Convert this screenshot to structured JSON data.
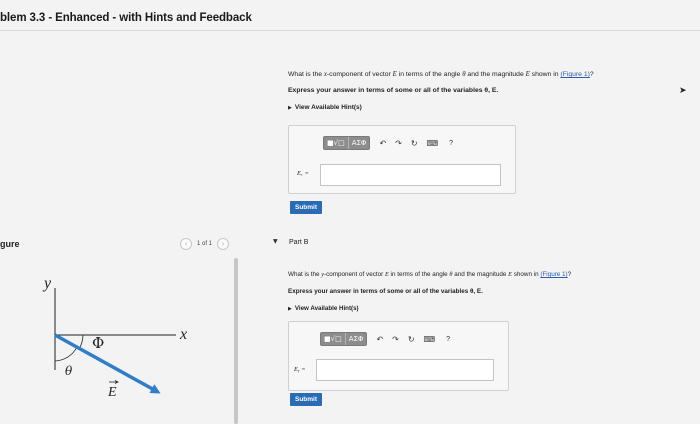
{
  "header": {
    "title": "blem 3.3 - Enhanced - with Hints and Feedback"
  },
  "figure_panel": {
    "label": "gure",
    "pager": {
      "prev_icon": "chevron-left-icon",
      "prev_glyph": "‹",
      "text": "1 of 1",
      "next_icon": "chevron-right-icon",
      "next_glyph": "›"
    },
    "labels": {
      "y_axis": "y",
      "x_axis": "x",
      "angle_phi": "Φ",
      "angle_theta": "θ",
      "vector": "E"
    },
    "colors": {
      "vector": "#2f7ec7",
      "axes": "#222222"
    }
  },
  "part_a": {
    "question_parts": [
      "What is the ",
      "x",
      "-component of vector ",
      "E",
      " in terms of the angle ",
      "θ",
      " and the magnitude ",
      "E",
      " shown in ",
      "(Figure 1)",
      "?"
    ],
    "instruction": "Express your answer in terms of some or all of the variables θ, E.",
    "hints_label": "View Available Hint(s)",
    "var_label": "Eₓ =",
    "input_value": "",
    "submit_label": "Submit"
  },
  "part_b": {
    "expand_icon": "▼",
    "title": "Part B",
    "question_parts": [
      "What is the ",
      "y",
      "-component of vector ",
      "E",
      " in terms of the angle ",
      "θ",
      " and the magnitude ",
      "E",
      " shown in ",
      "(Figure 1)",
      "?"
    ],
    "instruction": "Express your answer in terms of some or all of the variables θ, E.",
    "hints_label": "View Available Hint(s)",
    "var_label": "Eᵧ =",
    "input_value": "",
    "submit_label": "Submit"
  },
  "toolbar": {
    "templates_label": "■√□",
    "symbols_label": "ΑΣΦ",
    "undo_glyph": "↶",
    "redo_glyph": "↷",
    "reset_glyph": "↻",
    "keyboard_glyph": "⌨",
    "help_label": "?"
  },
  "accent_color": "#2a6bb5"
}
